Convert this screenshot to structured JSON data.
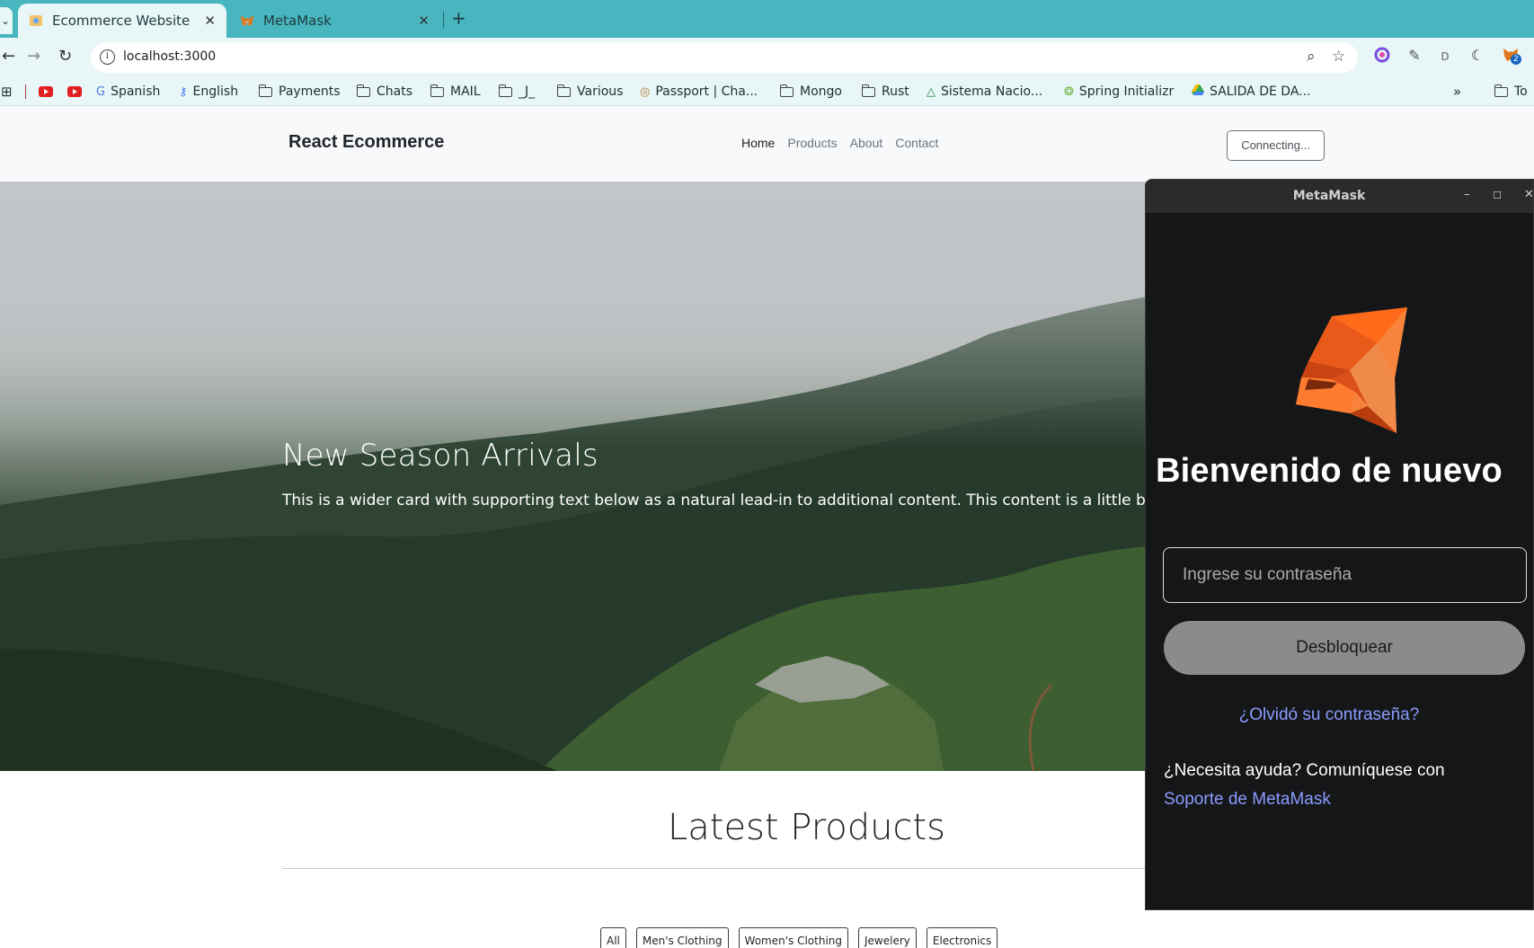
{
  "browser": {
    "tabs": [
      {
        "title": "Ecommerce Website",
        "active": true
      },
      {
        "title": "MetaMask",
        "active": false
      }
    ],
    "url": "localhost:3000",
    "bookmarks": [
      {
        "label": "Spanish",
        "icon": "translate-icon"
      },
      {
        "label": "English",
        "icon": "key-icon"
      },
      {
        "label": "Payments",
        "icon": "folder-icon"
      },
      {
        "label": "Chats",
        "icon": "folder-icon"
      },
      {
        "label": "MAIL",
        "icon": "folder-icon"
      },
      {
        "label": "_J_",
        "icon": "folder-icon"
      },
      {
        "label": "Various",
        "icon": "folder-icon"
      },
      {
        "label": "Passport | Cha...",
        "icon": "passport-icon"
      },
      {
        "label": "Mongo",
        "icon": "folder-icon"
      },
      {
        "label": "Rust",
        "icon": "folder-icon"
      },
      {
        "label": "Sistema Nacio...",
        "icon": "triangle-icon"
      },
      {
        "label": "Spring Initializr",
        "icon": "spring-icon"
      },
      {
        "label": "SALIDA DE DA...",
        "icon": "drive-icon"
      },
      {
        "label": "To",
        "icon": "folder-icon"
      }
    ],
    "ext_badge": "2"
  },
  "site": {
    "brand": "React Ecommerce",
    "nav": [
      "Home",
      "Products",
      "About",
      "Contact"
    ],
    "connect_label": "Connecting...",
    "hero_title": "New Season Arrivals",
    "hero_text": "This is a wider card with supporting text below as a natural lead-in to additional content. This content is a little bit long",
    "latest_title": "Latest Products",
    "filters": [
      "All",
      "Men's Clothing",
      "Women's Clothing",
      "Jewelery",
      "Electronics"
    ]
  },
  "metamask": {
    "window_title": "MetaMask",
    "welcome": "Bienvenido de nuevo",
    "password_placeholder": "Ingrese su contraseña",
    "unlock_label": "Desbloquear",
    "forgot_label": "¿Olvidó su contraseña?",
    "help_text": "¿Necesita ayuda? Comuníquese con ",
    "support_link": "Soporte de MetaMask"
  },
  "colors": {
    "tabbar": "#49b6bf",
    "toolbar": "#e8f6f7",
    "mm_background": "#141618",
    "mm_link": "#8b9cff"
  }
}
